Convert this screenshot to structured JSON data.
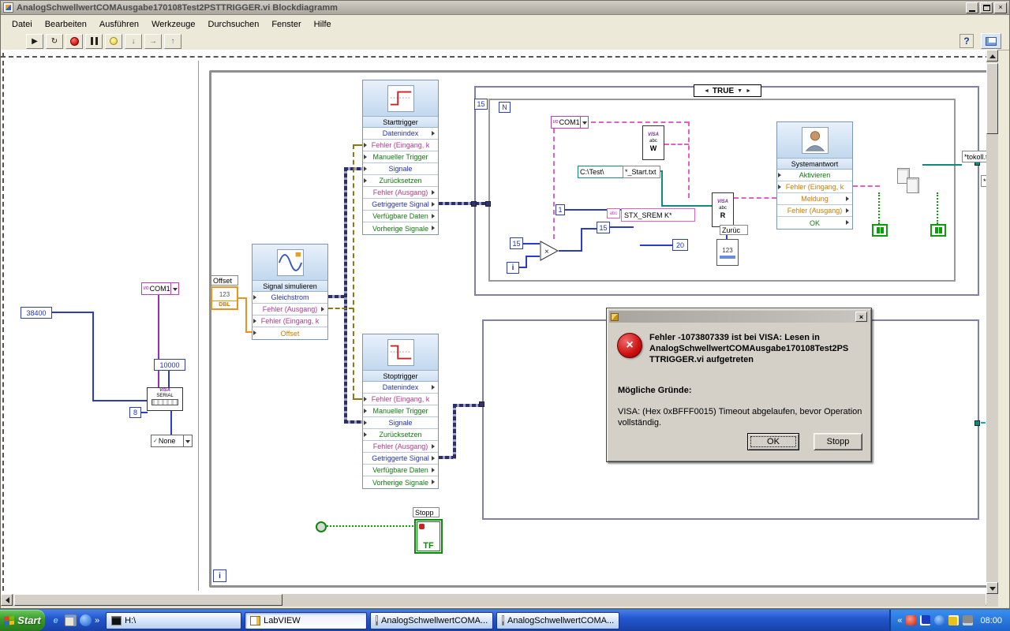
{
  "glyphs": {
    "close": "×",
    "run": "▶",
    "run_continuous": "↻",
    "step_into": "↓",
    "step_over": "→",
    "step_out": "↑",
    "case_left": "◄",
    "case_down": "▼",
    "case_right": "►",
    "check": "✓",
    "io": "I/O",
    "multiply": "×",
    "error_x": "×"
  },
  "window": {
    "title": "AnalogSchwellwertCOMAusgabe170108Test2PSTTRIGGER.vi Blockdiagramm"
  },
  "menu": {
    "items": [
      "Datei",
      "Bearbeiten",
      "Ausführen",
      "Werkzeuge",
      "Durchsuchen",
      "Fenster",
      "Hilfe"
    ]
  },
  "toolbar": {
    "help_label": "?"
  },
  "left_panel": {
    "baud": "38400",
    "com_port": "COM1",
    "timeout": "10000",
    "data_bits": "8",
    "visa_l1": "VISA",
    "visa_l2": "SERIAL",
    "flow_control": "None"
  },
  "diagram": {
    "offset_label": "Offset",
    "offset_digits": "123",
    "offset_type": "DBL",
    "simulate": {
      "title": "Signal simulieren",
      "rows": [
        "Gleichstrom",
        "Fehler (Ausgang)",
        "Fehler (Eingang, k",
        "Offset"
      ]
    },
    "starttrigger": {
      "title": "Starttrigger",
      "rows": [
        "Datenindex",
        "Fehler (Eingang, k",
        "Manueller Trigger",
        "Signale",
        "Zurücksetzen",
        "Fehler (Ausgang)",
        "Getriggerte Signal",
        "Verfügbare Daten",
        "Vorherige Signale"
      ]
    },
    "stoptrigger": {
      "title": "Stoptrigger",
      "rows": [
        "Datenindex",
        "Fehler (Eingang, k",
        "Manueller Trigger",
        "Signale",
        "Zurücksetzen",
        "Fehler (Ausgang)",
        "Getriggerte Signal",
        "Verfügbare Daten",
        "Vorherige Signale"
      ]
    },
    "system_response": {
      "title": "Systemantwort",
      "rows": [
        "Aktivieren",
        "Fehler (Eingang, k",
        "Meldung",
        "Fehler (Ausgang)",
        "OK"
      ]
    },
    "stop_label": "Stopp",
    "stop_tf": "TF",
    "while_iterator": "i",
    "case": {
      "selector": "TRUE",
      "count": "15",
      "loop_n": "N",
      "iterator": "i",
      "com_port": "COM1",
      "path": "C:\\Test\\",
      "file": "*_Start.txt",
      "one": "1",
      "string_icon": "abc",
      "command": "STX_SREM K*",
      "byte15_a": "15",
      "byte15_b": "15",
      "twenty": "20",
      "zurueck": "Zurüc",
      "convert": "123",
      "visa": "VISA",
      "abc": "abc",
      "write": "W",
      "read": "R"
    },
    "labels": {
      "protokoll1": "*tokoll.txt",
      "protokoll2": "*toko"
    }
  },
  "dialog": {
    "message": "Fehler -1073807339 ist bei VISA: Lesen in\nAnalogSchwellwertCOMAusgabe170108Test2PS\nTTRIGGER.vi aufgetreten",
    "reasons_heading": "Mögliche Gründe:",
    "reason": "VISA:  (Hex 0xBFFF0015) Timeout abgelaufen, bevor Operation\nvollständig.",
    "ok": "OK",
    "stop": "Stopp"
  },
  "taskbar": {
    "start": "Start",
    "ql_more": "»",
    "tasks": [
      {
        "label": "H:\\"
      },
      {
        "label": "LabVIEW"
      },
      {
        "label": "AnalogSchwellwertCOMA..."
      },
      {
        "label": "AnalogSchwellwertCOMA..."
      }
    ],
    "tray_more": "«",
    "clock": "08:00"
  },
  "colors": {
    "int_blue": "#2a3cc8",
    "bool_green": "#0aa00a",
    "error_magenta": "#b03a8a",
    "dbl_orange": "#e8941e",
    "visa_purple": "#b040c0",
    "path_teal": "#0e8a80",
    "dynamic_navy": "#32326e",
    "taskbar_blue": "#2257cf",
    "start_green": "#3a9a2c",
    "error_red": "#cc1111"
  }
}
